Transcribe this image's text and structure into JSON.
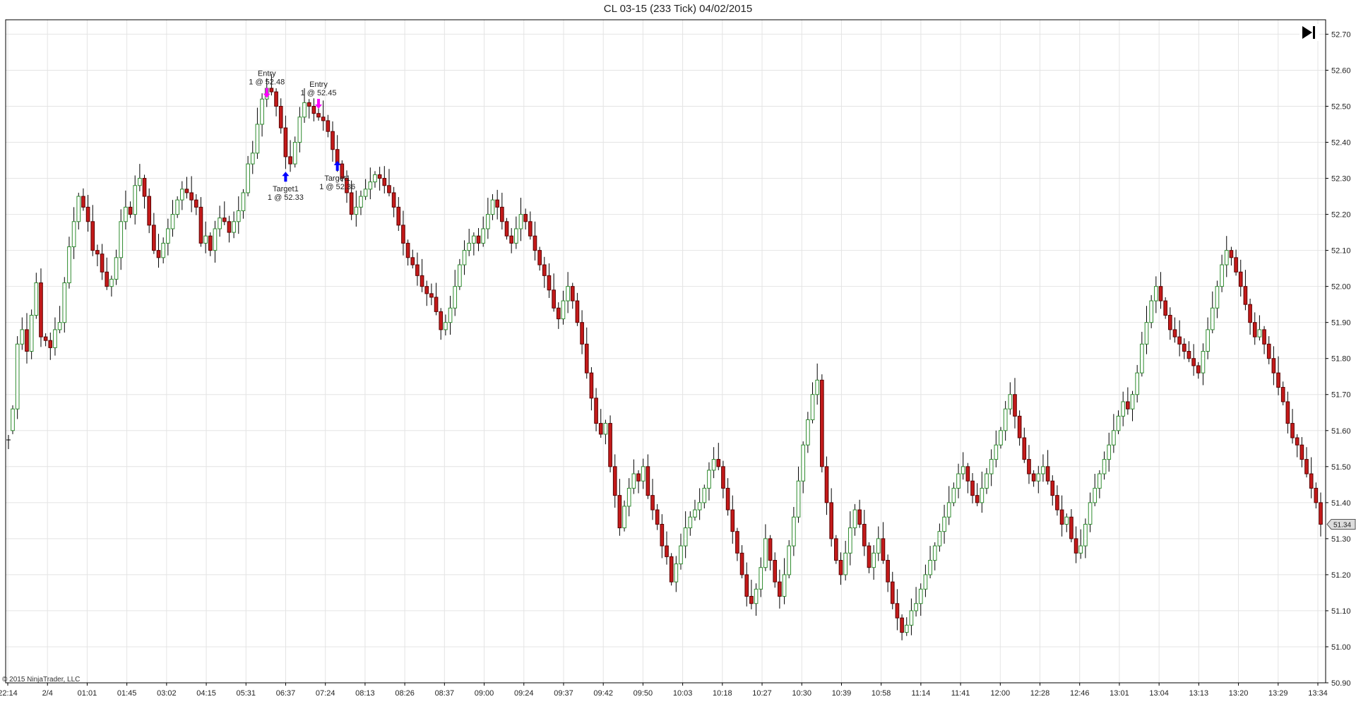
{
  "title": "CL 03-15 (233 Tick)  04/02/2015",
  "copyright": "© 2015 NinjaTrader, LLC",
  "last_price_label": "51.34",
  "colors": {
    "up_fill": "#ffffff",
    "up_body": "#2e8b2e",
    "down_fill": "#c41a1a",
    "wick": "#000000",
    "grid": "#e4e4e4",
    "entry_arrow": "#ff00ff",
    "target_arrow": "#0000ff"
  },
  "chart_data": {
    "type": "candlestick",
    "title": "CL 03-15 (233 Tick)  04/02/2015",
    "ylim": [
      50.9,
      52.74
    ],
    "y_ticks": [
      "52.70",
      "52.60",
      "52.50",
      "52.40",
      "52.30",
      "52.20",
      "52.10",
      "52.00",
      "51.90",
      "51.80",
      "51.70",
      "51.60",
      "51.50",
      "51.40",
      "51.30",
      "51.20",
      "51.10",
      "51.00",
      "50.90"
    ],
    "x_ticks": [
      "22:14",
      "2/4",
      "01:01",
      "01:45",
      "03:02",
      "04:15",
      "05:31",
      "06:37",
      "07:24",
      "08:13",
      "08:26",
      "08:37",
      "09:00",
      "09:24",
      "09:37",
      "09:42",
      "09:50",
      "10:03",
      "10:18",
      "10:27",
      "10:30",
      "10:39",
      "10:58",
      "11:14",
      "11:41",
      "12:00",
      "12:28",
      "12:46",
      "13:01",
      "13:04",
      "13:13",
      "13:20",
      "13:29",
      "13:34"
    ],
    "grid": true,
    "last_price": 51.34,
    "closes": [
      51.66,
      51.84,
      51.88,
      51.82,
      51.92,
      52.01,
      51.86,
      51.85,
      51.83,
      51.88,
      51.9,
      52.01,
      52.11,
      52.18,
      52.25,
      52.22,
      52.18,
      52.1,
      52.09,
      52.04,
      52.0,
      52.02,
      52.08,
      52.18,
      52.22,
      52.2,
      52.28,
      52.3,
      52.25,
      52.17,
      52.1,
      52.08,
      52.12,
      52.16,
      52.2,
      52.24,
      52.27,
      52.26,
      52.24,
      52.22,
      52.12,
      52.14,
      52.1,
      52.16,
      52.19,
      52.18,
      52.15,
      52.18,
      52.21,
      52.26,
      52.34,
      52.37,
      52.45,
      52.52,
      52.55,
      52.54,
      52.5,
      52.44,
      52.36,
      52.34,
      52.4,
      52.47,
      52.51,
      52.5,
      52.48,
      52.47,
      52.46,
      52.43,
      52.38,
      52.34,
      52.3,
      52.26,
      52.2,
      52.22,
      52.25,
      52.27,
      52.29,
      52.31,
      52.3,
      52.28,
      52.26,
      52.22,
      52.17,
      52.12,
      52.08,
      52.06,
      52.03,
      52.0,
      51.98,
      51.97,
      51.93,
      51.88,
      51.9,
      51.94,
      52.0,
      52.06,
      52.1,
      52.12,
      52.14,
      52.12,
      52.16,
      52.2,
      52.24,
      52.22,
      52.18,
      52.14,
      52.12,
      52.16,
      52.2,
      52.18,
      52.14,
      52.1,
      52.06,
      52.03,
      51.99,
      51.94,
      51.91,
      51.96,
      52.0,
      51.96,
      51.9,
      51.84,
      51.76,
      51.69,
      51.62,
      51.59,
      51.62,
      51.5,
      51.42,
      51.33,
      51.39,
      51.44,
      51.48,
      51.46,
      51.5,
      51.42,
      51.38,
      51.34,
      51.28,
      51.25,
      51.18,
      51.23,
      51.28,
      51.33,
      51.36,
      51.38,
      51.4,
      51.44,
      51.49,
      51.52,
      51.5,
      51.44,
      51.38,
      51.32,
      51.26,
      51.2,
      51.14,
      51.12,
      51.16,
      51.22,
      51.3,
      51.24,
      51.18,
      51.14,
      51.2,
      51.28,
      51.36,
      51.46,
      51.56,
      51.63,
      51.7,
      51.74,
      51.5,
      51.4,
      51.3,
      51.24,
      51.2,
      51.26,
      51.33,
      51.38,
      51.34,
      51.28,
      51.22,
      51.26,
      51.3,
      51.24,
      51.18,
      51.12,
      51.08,
      51.04,
      51.06,
      51.1,
      51.12,
      51.16,
      51.2,
      51.24,
      51.28,
      51.32,
      51.36,
      51.4,
      51.44,
      51.48,
      51.5,
      51.46,
      51.42,
      51.4,
      51.44,
      51.48,
      51.52,
      51.56,
      51.6,
      51.66,
      51.7,
      51.64,
      51.58,
      51.52,
      51.48,
      51.46,
      51.48,
      51.5,
      51.46,
      51.42,
      51.38,
      51.34,
      51.36,
      51.3,
      51.26,
      51.28,
      51.34,
      51.4,
      51.44,
      51.48,
      51.52,
      51.56,
      51.6,
      51.64,
      51.68,
      51.66,
      51.7,
      51.76,
      51.84,
      51.9,
      51.96,
      52.0,
      51.96,
      51.92,
      51.88,
      51.86,
      51.84,
      51.82,
      51.8,
      51.78,
      51.76,
      51.82,
      51.88,
      51.94,
      52.0,
      52.06,
      52.1,
      52.08,
      52.04,
      52.0,
      51.95,
      51.9,
      51.86,
      51.88,
      51.84,
      51.8,
      51.76,
      51.72,
      51.68,
      51.62,
      51.58,
      51.56,
      51.52,
      51.48,
      51.44,
      51.4,
      51.34
    ]
  },
  "annotations": [
    {
      "kind": "entry",
      "line1": "Entry",
      "line2": "1 @ 52.48",
      "bar": 54,
      "price": 52.48
    },
    {
      "kind": "entry",
      "line1": "Entry",
      "line2": "1 @ 52.45",
      "bar": 65,
      "price": 52.45
    },
    {
      "kind": "target",
      "line1": "Target1",
      "line2": "1 @ 52.33",
      "bar": 58,
      "price": 52.33
    },
    {
      "kind": "target",
      "line1": "Target1",
      "line2": "1 @ 52.36",
      "bar": 69,
      "price": 52.36
    }
  ]
}
